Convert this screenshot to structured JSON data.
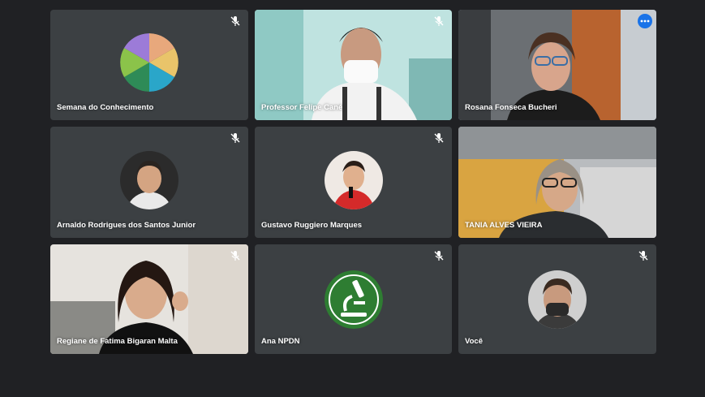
{
  "participants": [
    {
      "name": "Semana do Conhecimento",
      "muted": true,
      "avatar_icon": "colorful-circle-logo-icon"
    },
    {
      "name": "Professor Felipe Cané",
      "muted": true
    },
    {
      "name": "Rosana Fonseca Bucheri",
      "muted": false,
      "active_speaker": true
    },
    {
      "name": "Arnaldo Rodrigues dos Santos Junior",
      "muted": true
    },
    {
      "name": "Gustavo Ruggiero Marques",
      "muted": true
    },
    {
      "name": "TANIA ALVES VIEIRA",
      "muted": false
    },
    {
      "name": "Regiane de Fatima Bigaran Malta",
      "muted": true
    },
    {
      "name": "Ana NPDN",
      "muted": true,
      "avatar_icon": "microscope-icon"
    },
    {
      "name": "Você",
      "muted": true
    }
  ],
  "colors": {
    "background": "#202124",
    "tile": "#3c4043",
    "active_border": "#8ab4f8",
    "more_button": "#1a73e8",
    "npdn_green": "#2e7d32"
  }
}
